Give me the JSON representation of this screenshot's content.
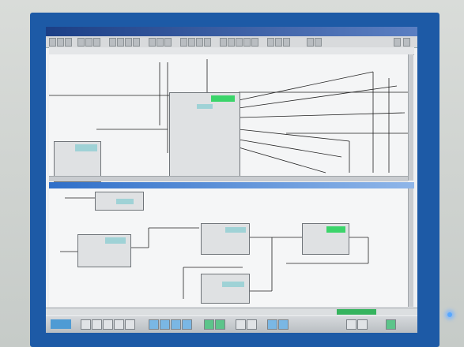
{
  "app": {
    "window_title": "",
    "editor_title_top": "",
    "editor_title_bottom": "",
    "status_text": "",
    "start_label": ""
  },
  "colors": {
    "bezel": "#1d5aa6",
    "highlight_cyan": "#9fd2d6",
    "highlight_green": "#3bd46a",
    "title_active": "#2f6fc9",
    "status_ok": "#35b45e"
  },
  "icons": [
    "function-block-icon",
    "scrollbar-icon",
    "taskbar-icon"
  ]
}
